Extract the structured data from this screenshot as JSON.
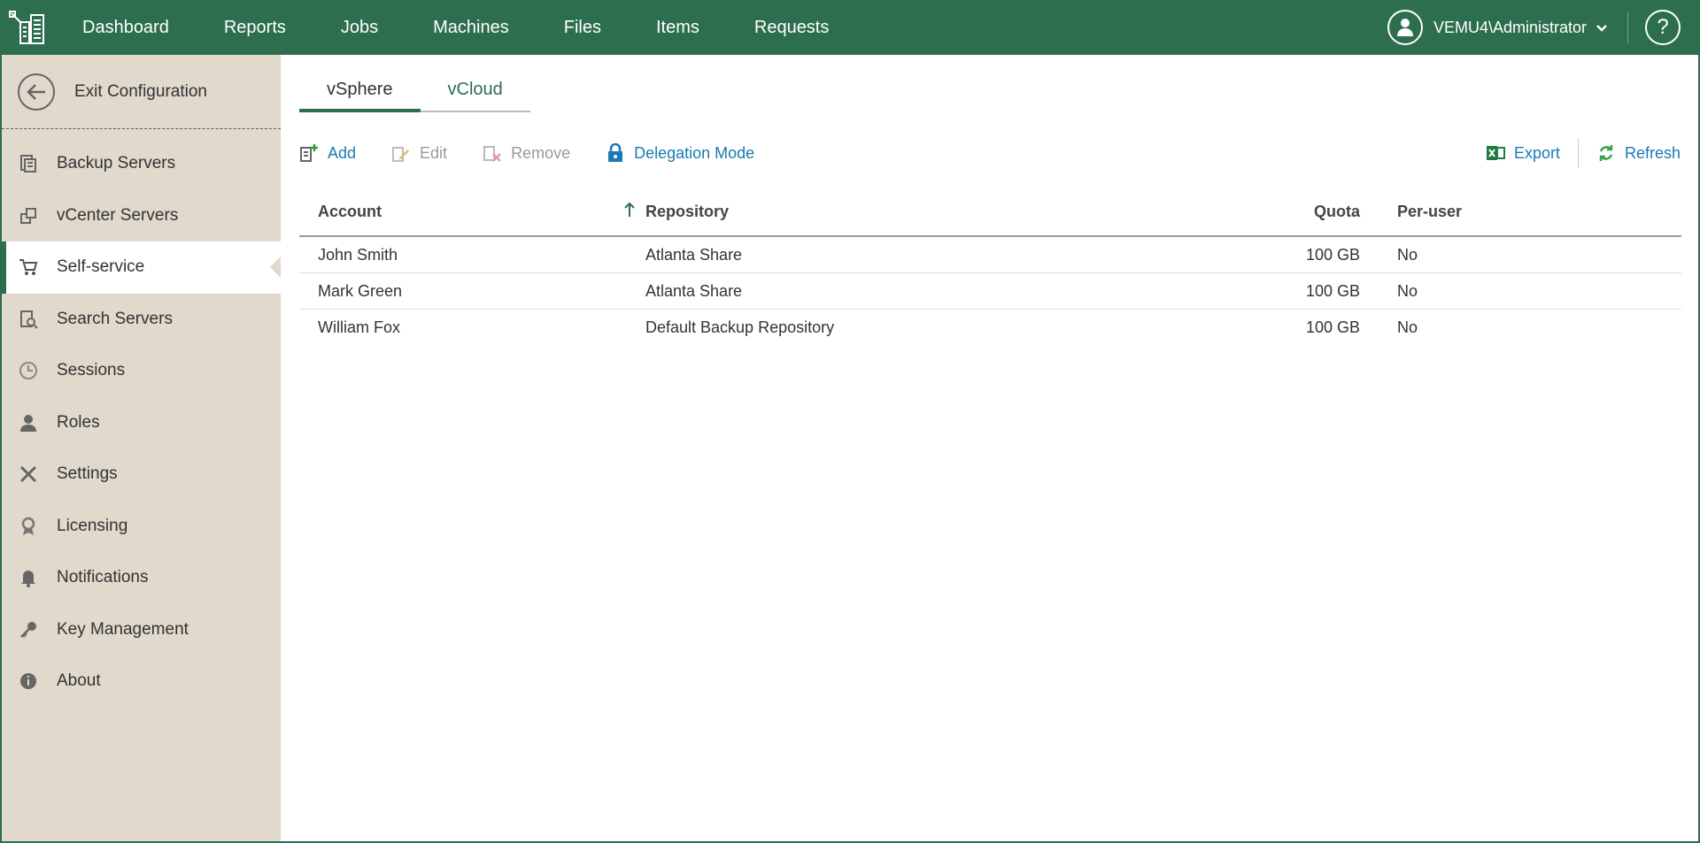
{
  "topbar": {
    "nav": [
      "Dashboard",
      "Reports",
      "Jobs",
      "Machines",
      "Files",
      "Items",
      "Requests"
    ],
    "user": "VEMU4\\Administrator",
    "help": "?"
  },
  "sidebar": {
    "exit_label": "Exit Configuration",
    "items": [
      {
        "label": "Backup Servers",
        "icon": "backup-servers-icon"
      },
      {
        "label": "vCenter Servers",
        "icon": "vcenter-servers-icon"
      },
      {
        "label": "Self-service",
        "icon": "cart-icon",
        "active": true
      },
      {
        "label": "Search Servers",
        "icon": "search-servers-icon"
      },
      {
        "label": "Sessions",
        "icon": "clock-icon"
      },
      {
        "label": "Roles",
        "icon": "person-icon"
      },
      {
        "label": "Settings",
        "icon": "tools-icon"
      },
      {
        "label": "Licensing",
        "icon": "license-icon"
      },
      {
        "label": "Notifications",
        "icon": "bell-icon"
      },
      {
        "label": "Key Management",
        "icon": "key-icon"
      },
      {
        "label": "About",
        "icon": "info-icon"
      }
    ]
  },
  "tabs": [
    {
      "label": "vSphere",
      "active": true
    },
    {
      "label": "vCloud",
      "active": false
    }
  ],
  "toolbar": {
    "add": "Add",
    "edit": "Edit",
    "remove": "Remove",
    "delegation": "Delegation Mode",
    "export": "Export",
    "refresh": "Refresh"
  },
  "table": {
    "headers": {
      "account": "Account",
      "repository": "Repository",
      "quota": "Quota",
      "per_user": "Per-user"
    },
    "rows": [
      {
        "account": "John Smith",
        "repository": "Atlanta Share",
        "quota": "100 GB",
        "per_user": "No"
      },
      {
        "account": "Mark Green",
        "repository": "Atlanta Share",
        "quota": "100 GB",
        "per_user": "No"
      },
      {
        "account": "William Fox",
        "repository": "Default Backup Repository",
        "quota": "100 GB",
        "per_user": "No"
      }
    ]
  },
  "colors": {
    "brand": "#2d6e4f",
    "sidebar": "#e0d9cc",
    "link": "#1a7ab3"
  }
}
